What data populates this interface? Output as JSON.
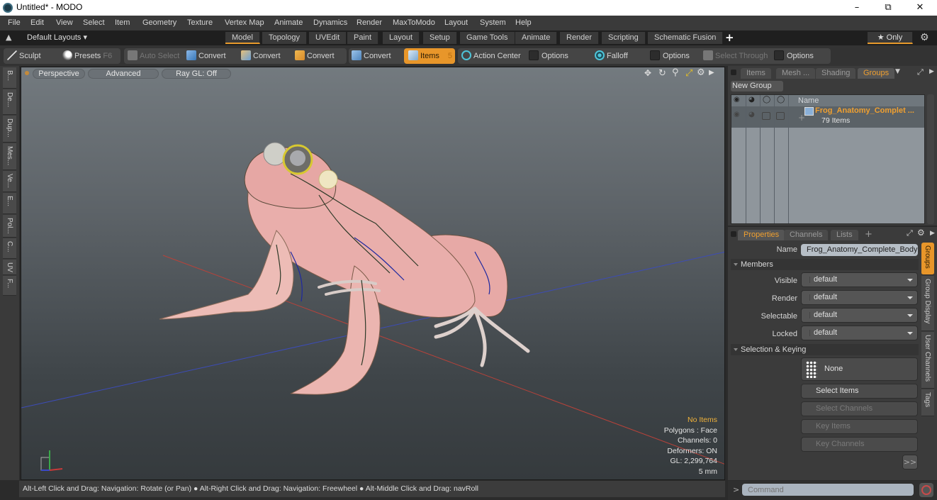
{
  "window": {
    "title": "Untitled* - MODO",
    "controls": [
      "minimize",
      "restore",
      "close"
    ]
  },
  "menu": [
    "File",
    "Edit",
    "View",
    "Select",
    "Item",
    "Geometry",
    "Texture",
    "Vertex Map",
    "Animate",
    "Dynamics",
    "Render",
    "MaxToModo",
    "Layout",
    "System",
    "Help"
  ],
  "layoutbar": {
    "layouts_label": "Default Layouts ▾",
    "tabs": [
      "Model",
      "Topology",
      "UVEdit",
      "Paint",
      "Layout",
      "Setup",
      "Game Tools",
      "Animate",
      "Render",
      "Scripting",
      "Schematic Fusion"
    ],
    "active_tab": "Model",
    "add_label": "+",
    "only_label": "★ Only"
  },
  "toolbar": {
    "sculpt": "Sculpt",
    "presets": "Presets",
    "presets_key": "F6",
    "auto_select": "Auto Select",
    "convert1": "Convert",
    "convert2": "Convert",
    "convert3": "Convert",
    "convert4": "Convert",
    "items": "Items",
    "items_key": "5",
    "action_center": "Action Center",
    "options1": "Options",
    "falloff": "Falloff",
    "options2": "Options",
    "select_through": "Select Through",
    "options3": "Options"
  },
  "left_strip": [
    "B...",
    "De...",
    "Dup...",
    "Mes...",
    "Ve...",
    "E...",
    "Pol...",
    "C...",
    "UV",
    "F..."
  ],
  "viewport": {
    "view_mode": "Perspective",
    "shading": "Advanced",
    "raygl": "Ray GL: Off",
    "hud": {
      "selection": "No Items",
      "polygons": "Polygons : Face",
      "channels": "Channels: 0",
      "deformers": "Deformers: ON",
      "gl": "GL: 2,299,764",
      "grid": "5 mm"
    },
    "colors": {
      "hud_highlight": "#f0b23a",
      "x_axis": "#c0443c",
      "z_axis": "#3a49b8"
    }
  },
  "statusbar": {
    "hint1": "Alt-Left Click and Drag: Navigation: Rotate (or Pan)",
    "hint2": "Alt-Right Click and Drag: Navigation: Freewheel",
    "hint3": "Alt-Middle Click and Drag: navRoll"
  },
  "groups_panel": {
    "tabs": [
      "Items",
      "Mesh ...",
      "Shading",
      "Groups"
    ],
    "active_tab": "Groups",
    "new_group": "New Group",
    "column_name": "Name",
    "rows": [
      {
        "name": "Frog_Anatomy_Complet ...",
        "count": "79 Items"
      }
    ]
  },
  "properties_panel": {
    "tabs": [
      "Properties",
      "Channels",
      "Lists"
    ],
    "active_tab": "Properties",
    "add_label": "+",
    "name_label": "Name",
    "name_value": "Frog_Anatomy_Complete_Body (",
    "members_section": "Members",
    "fields": [
      {
        "label": "Visible",
        "value": "default"
      },
      {
        "label": "Render",
        "value": "default"
      },
      {
        "label": "Selectable",
        "value": "default"
      },
      {
        "label": "Locked",
        "value": "default"
      }
    ],
    "selection_section": "Selection & Keying",
    "none_label": "None",
    "select_items": "Select Items",
    "select_channels": "Select Channels",
    "key_items": "Key Items",
    "key_channels": "Key Channels",
    "more": ">>",
    "side_tabs": [
      "Groups",
      "Group Display",
      "User Channels",
      "Tags"
    ],
    "active_side_tab": "Groups"
  },
  "command": {
    "prompt": ">",
    "placeholder": "Command"
  }
}
